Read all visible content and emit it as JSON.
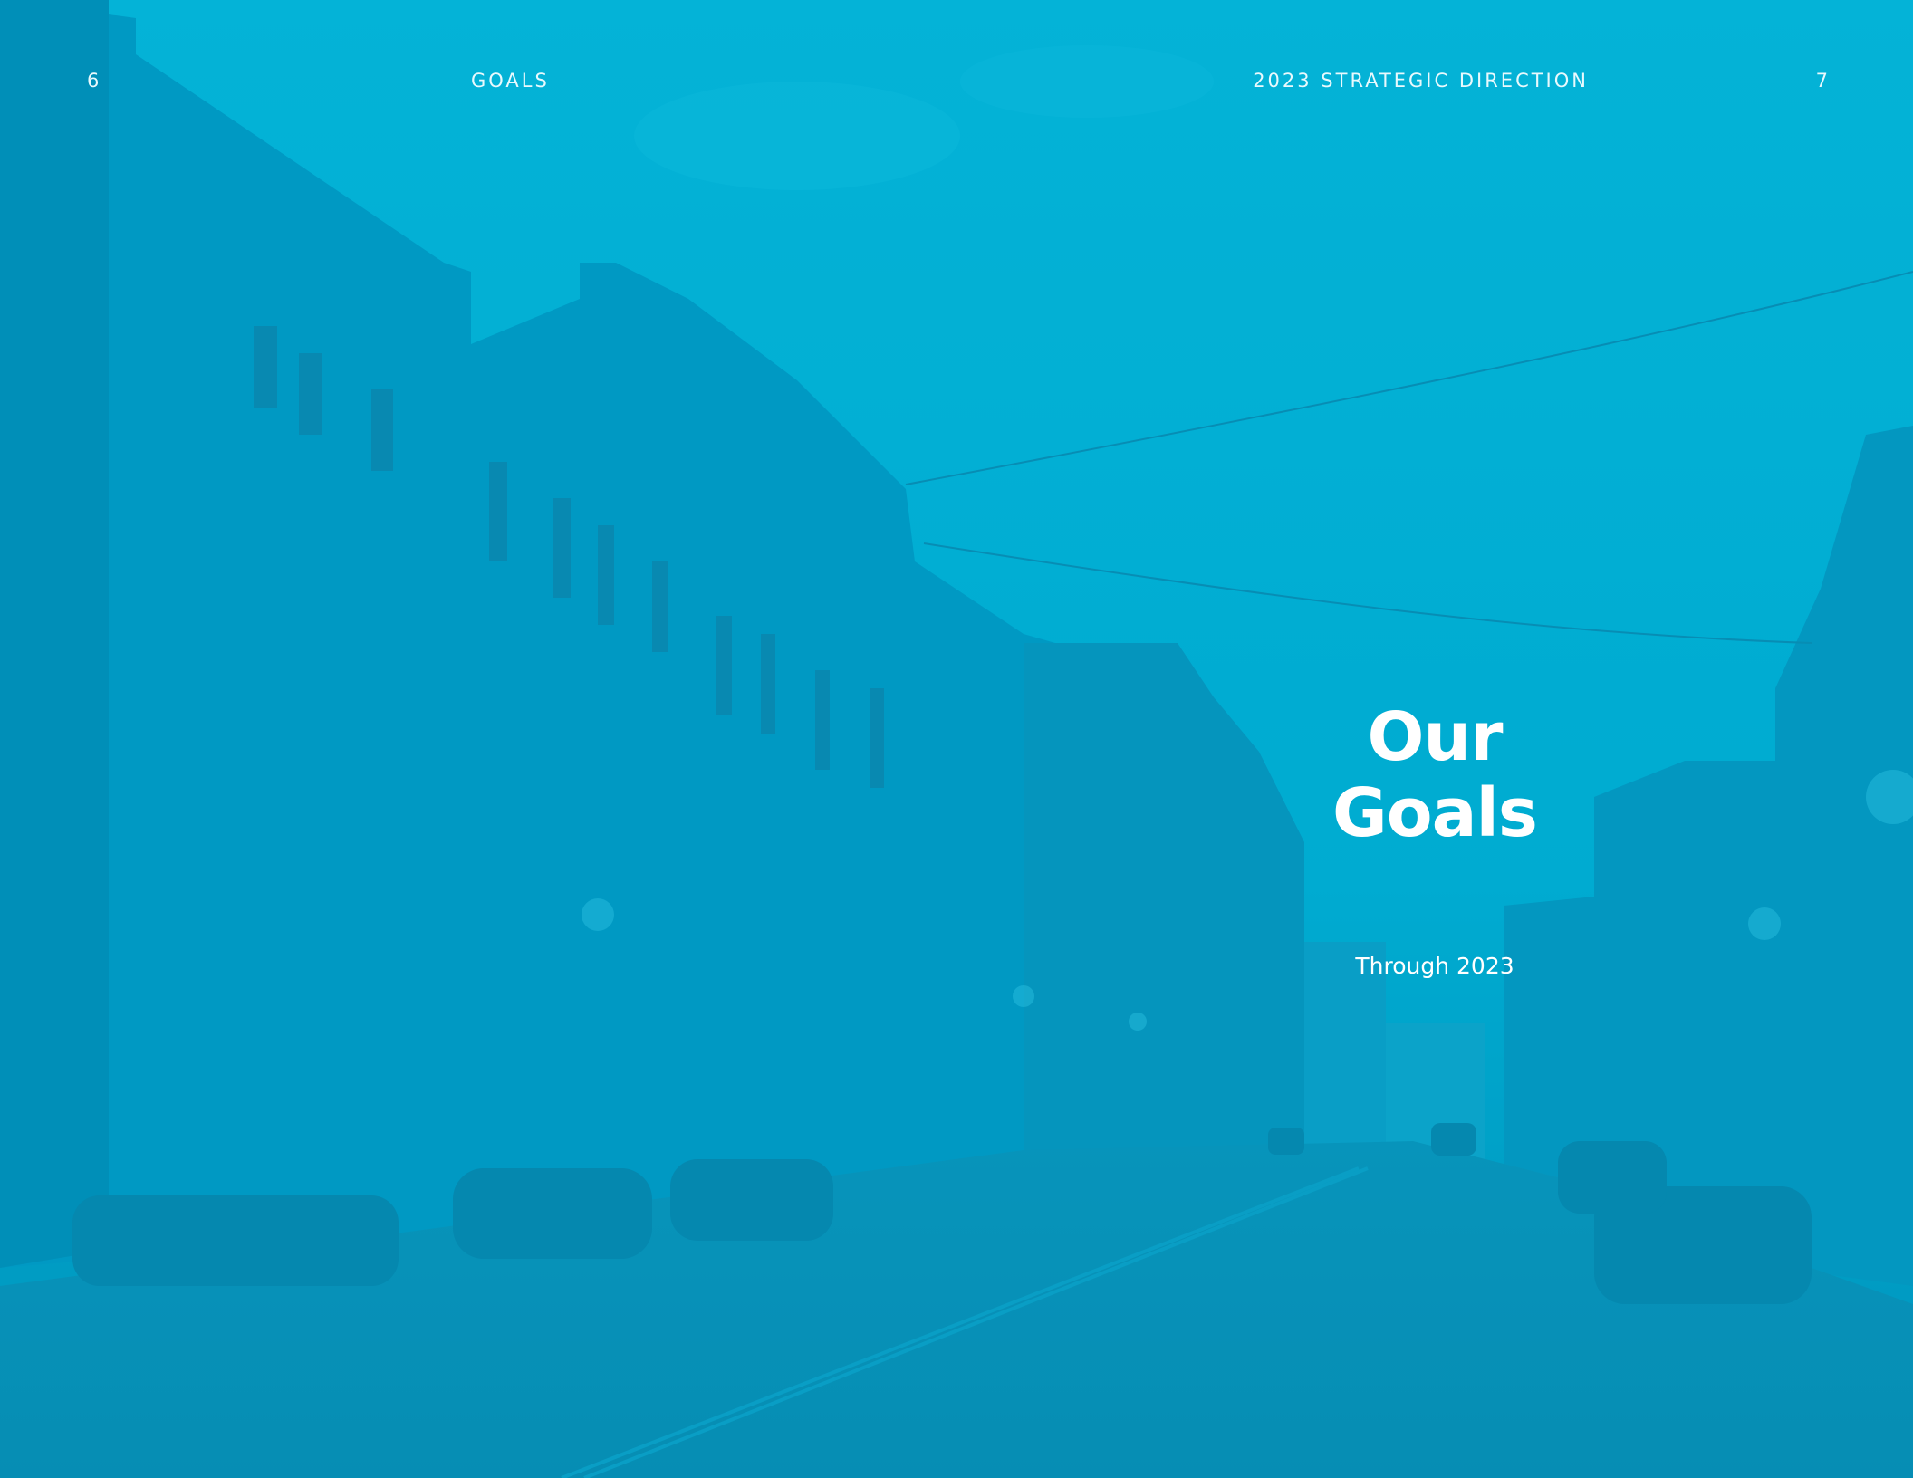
{
  "header": {
    "left_page_number": "6",
    "section_label": "GOALS",
    "document_title": "2023 STRATEGIC DIRECTION",
    "right_page_number": "7"
  },
  "hero": {
    "title_lines": [
      "Our",
      "Goals"
    ],
    "subtitle": "Through 2023"
  },
  "colors": {
    "overlay": "#00a9cf",
    "text": "#ffffff"
  },
  "photo": {
    "subject": "street-scene-photo"
  }
}
